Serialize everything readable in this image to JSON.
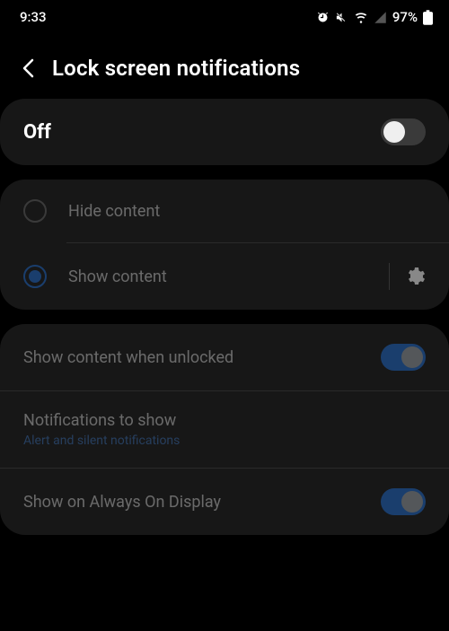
{
  "status": {
    "time": "9:33",
    "battery": "97%"
  },
  "header": {
    "title": "Lock screen notifications"
  },
  "master": {
    "state_label": "Off",
    "enabled": false
  },
  "content_options": {
    "hide_label": "Hide content",
    "show_label": "Show content",
    "selected": "show"
  },
  "settings": {
    "show_unlocked_label": "Show content when unlocked",
    "show_unlocked_on": true,
    "notif_to_show_label": "Notifications to show",
    "notif_to_show_value": "Alert and silent notifications",
    "aod_label": "Show on Always On Display",
    "aod_on": true
  }
}
